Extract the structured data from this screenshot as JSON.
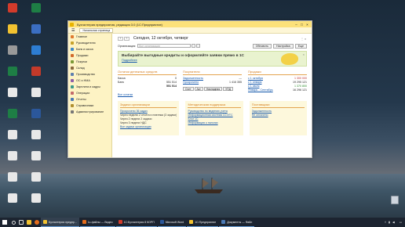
{
  "desktop": {
    "icons": [
      {
        "label": "",
        "color": "#d33b2b"
      },
      {
        "label": "",
        "color": "#1e7e45"
      },
      {
        "label": "",
        "color": "#f2c230"
      },
      {
        "label": "",
        "color": "#3b6ec2"
      },
      {
        "label": "",
        "color": "#999999"
      },
      {
        "label": "",
        "color": "#2d7dd2"
      },
      {
        "label": "",
        "color": "#1e7e45"
      },
      {
        "label": "",
        "color": "#c43a2a"
      },
      {
        "label": "",
        "color": "#e8e8e8"
      },
      {
        "label": "",
        "color": "#e8e8e8"
      },
      {
        "label": "",
        "color": "#1e7e45"
      },
      {
        "label": "",
        "color": "#2b579a"
      },
      {
        "label": "",
        "color": "#e8e8e8"
      },
      {
        "label": "",
        "color": "#e8e8e8"
      },
      {
        "label": "",
        "color": "#e8e8e8"
      },
      {
        "label": "",
        "color": "#e8e8e8"
      },
      {
        "label": "",
        "color": "#e8e8e8"
      },
      {
        "label": "",
        "color": "#e8e8e8"
      },
      {
        "label": "",
        "color": "#e8e8e8"
      },
      {
        "label": "",
        "color": "#e8e8e8"
      }
    ],
    "trash_label": ""
  },
  "app": {
    "window_title": "Бухгалтерия предприятия, редакция 3.0 (1С:Предприятие)",
    "home_tab": "Начальная страница",
    "sidebar": [
      {
        "label": "Главное",
        "color": "#e07a2f"
      },
      {
        "label": "Руководителю",
        "color": "#c7a22a"
      },
      {
        "label": "Банк и касса",
        "color": "#3f8ac9"
      },
      {
        "label": "Продажи",
        "color": "#d16a2b"
      },
      {
        "label": "Покупки",
        "color": "#7a9a36"
      },
      {
        "label": "Склад",
        "color": "#8a6a3c"
      },
      {
        "label": "Производство",
        "color": "#5e7fae"
      },
      {
        "label": "ОС и НМА",
        "color": "#8e5fa8"
      },
      {
        "label": "Зарплата и кадры",
        "color": "#3c9a8a"
      },
      {
        "label": "Операции",
        "color": "#c46a6a"
      },
      {
        "label": "Отчеты",
        "color": "#4a79b5"
      },
      {
        "label": "Справочники",
        "color": "#b08f2f"
      },
      {
        "label": "Администрирование",
        "color": "#777777"
      }
    ],
    "page_title": "Сегодня, 12 октября, четверг",
    "org_label": "Организация:",
    "org_placeholder": "Все организации",
    "settings_btn": "Настройка",
    "more_btn": "Еще",
    "refresh_btn": "Обновить",
    "banner_title": "Выбирайте выгодные кредиты и оформляйте заявки прямо в 1С",
    "banner_link": "Подробнее",
    "money": {
      "head": "Остатки денежных средств",
      "rows": [
        {
          "k": "Касса",
          "v": "0"
        },
        {
          "k": "Банк",
          "v": "551 514"
        },
        {
          "k": "",
          "v": "551 514"
        }
      ],
      "all": "Все остатки"
    },
    "buyers": {
      "head": "Покупатели",
      "rows": [
        {
          "k": "Задолженность",
          "v": "—"
        },
        {
          "k": "Просрочено",
          "v": "1 416 355"
        }
      ],
      "btns": [
        "Счет",
        "Акт",
        "Накладная",
        "УПД"
      ]
    },
    "sales": {
      "head": "Продажи",
      "rows": [
        {
          "k": "с 1 октября",
          "v": "1 300 000",
          "tone": "red"
        },
        {
          "k": "с 1 января",
          "v": "19 295 121",
          "tone": ""
        },
        {
          "k": "с 1 июля",
          "v": "1 370 800",
          "tone": "green"
        },
        {
          "k": "Январь - Сентябрь",
          "v": "16 296 121",
          "tone": ""
        }
      ]
    },
    "tasks": {
      "head": "Задачи организации",
      "lines": [
        {
          "t": "Просрочено 36 задач",
          "link": true
        },
        {
          "t": "Через неделю 2 отчета и платежа (3 задачи)",
          "link": false
        },
        {
          "t": "Через 2 недели 2 задачи",
          "link": false
        },
        {
          "t": "Через 3 недели НДС",
          "link": false
        },
        {
          "t": "Все задачи организации",
          "link": true
        }
      ]
    },
    "method": {
      "head": "Методическая поддержка",
      "lines": [
        {
          "t": "Руководство по ведению учета",
          "link": true
        },
        {
          "t": "Информационная система 1С:ИТС",
          "link": true
        },
        {
          "t": "Блог 1С",
          "link": true
        },
        {
          "t": "Информация о налогах",
          "link": true
        }
      ]
    },
    "supply": {
      "head": "Поставщики",
      "lines": [
        {
          "t": "Задолженность",
          "link": true
        },
        {
          "t": "Не оплачено",
          "link": true
        }
      ]
    }
  },
  "taskbar": {
    "items": [
      {
        "label": "Бухгалтерия предпр...",
        "color": "#f2c230",
        "active": true
      },
      {
        "label": "1с-файлы — Видео",
        "color": "#e36c1c",
        "active": false
      },
      {
        "label": "1С:Бухгалтерия 8 КОРП",
        "color": "#d33b2b",
        "active": false
      },
      {
        "label": "Microsoft Word",
        "color": "#2b579a",
        "active": false
      },
      {
        "label": "1С:Предприятие",
        "color": "#f2c230",
        "active": false
      },
      {
        "label": "Документы — Файл",
        "color": "#4a79b5",
        "active": false
      }
    ],
    "time": "",
    "date": ""
  }
}
